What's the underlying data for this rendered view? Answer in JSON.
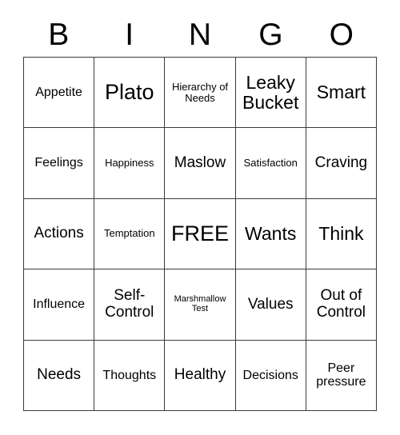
{
  "card": {
    "title_letters": [
      "B",
      "I",
      "N",
      "G",
      "O"
    ],
    "rows": [
      [
        {
          "label": "Appetite",
          "size": "sm"
        },
        {
          "label": "Plato",
          "size": "xl"
        },
        {
          "label": "Hierarchy of Needs",
          "size": "xs"
        },
        {
          "label": "Leaky Bucket",
          "size": "lg"
        },
        {
          "label": "Smart",
          "size": "lg"
        }
      ],
      [
        {
          "label": "Feelings",
          "size": "sm"
        },
        {
          "label": "Happiness",
          "size": "xs"
        },
        {
          "label": "Maslow",
          "size": "md"
        },
        {
          "label": "Satisfaction",
          "size": "xs"
        },
        {
          "label": "Craving",
          "size": "md"
        }
      ],
      [
        {
          "label": "Actions",
          "size": "md"
        },
        {
          "label": "Temptation",
          "size": "xs"
        },
        {
          "label": "FREE",
          "size": "xl"
        },
        {
          "label": "Wants",
          "size": "lg"
        },
        {
          "label": "Think",
          "size": "lg"
        }
      ],
      [
        {
          "label": "Influence",
          "size": "sm"
        },
        {
          "label": "Self-Control",
          "size": "md"
        },
        {
          "label": "Marshmallow Test",
          "size": "xxs"
        },
        {
          "label": "Values",
          "size": "md"
        },
        {
          "label": "Out of Control",
          "size": "md"
        }
      ],
      [
        {
          "label": "Needs",
          "size": "md"
        },
        {
          "label": "Thoughts",
          "size": "sm"
        },
        {
          "label": "Healthy",
          "size": "md"
        },
        {
          "label": "Decisions",
          "size": "sm"
        },
        {
          "label": "Peer pressure",
          "size": "sm"
        }
      ]
    ],
    "colors": {
      "border": "#3a3a3a",
      "text": "#000000",
      "background": "#ffffff"
    }
  }
}
